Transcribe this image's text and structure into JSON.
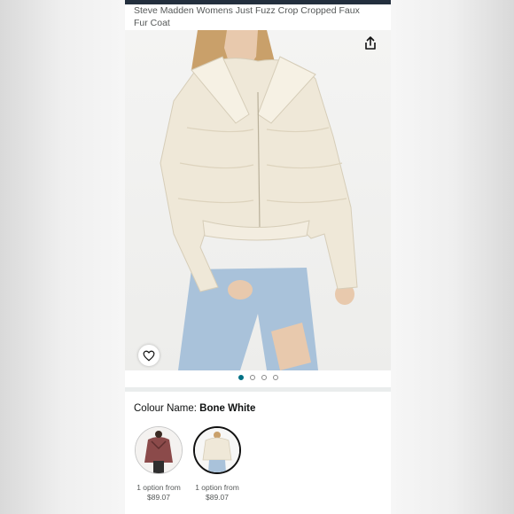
{
  "product": {
    "title": "Steve Madden Womens Just Fuzz Crop Cropped Faux Fur Coat"
  },
  "gallery": {
    "image_count": 4,
    "active_index": 0,
    "share_icon": "share-icon",
    "favorite_icon": "heart-icon"
  },
  "colour": {
    "label": "Colour Name: ",
    "value": "Bone White"
  },
  "swatches": [
    {
      "line1": "1 option from",
      "price": "$89.07",
      "selected": false
    },
    {
      "line1": "1 option from",
      "price": "$89.07",
      "selected": true
    }
  ],
  "colors": {
    "accent": "#007185",
    "topbar": "#232f3e",
    "text": "#0f1111",
    "muted": "#565959"
  }
}
